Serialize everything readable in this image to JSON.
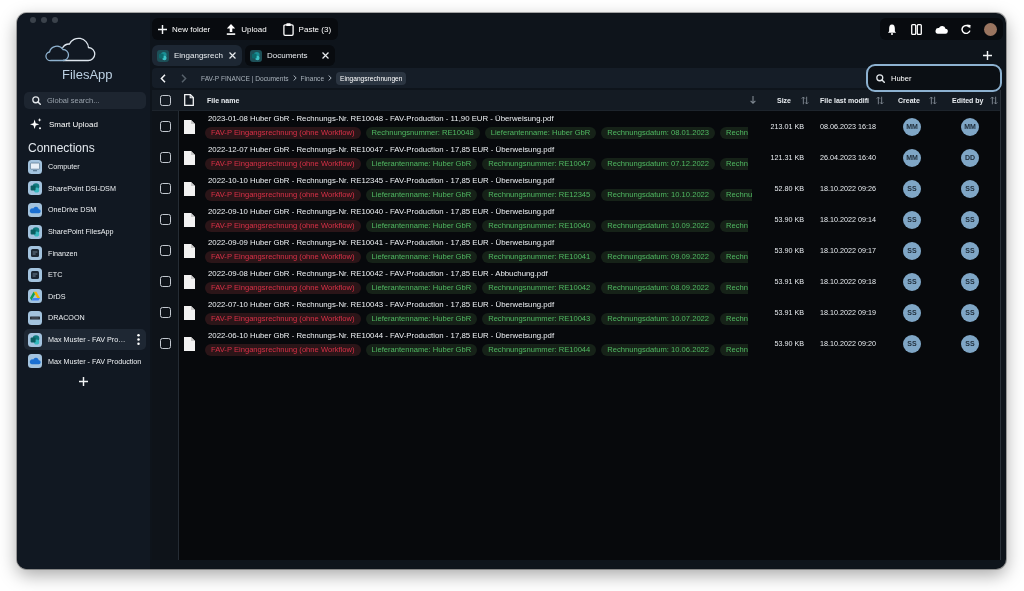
{
  "sidebar": {
    "app_name": "FilesApp",
    "search": {
      "placeholder": "Global search..."
    },
    "smart_upload": "Smart Upload",
    "connections_title": "Connections",
    "connections": [
      {
        "label": "Computer",
        "kind": "computer",
        "selected": false
      },
      {
        "label": "SharePoint DSI-DSM",
        "kind": "sharepoint",
        "selected": false
      },
      {
        "label": "OneDrive DSM",
        "kind": "onedrive",
        "selected": false
      },
      {
        "label": "SharePoint FilesApp",
        "kind": "sharepoint",
        "selected": false
      },
      {
        "label": "Finanzen",
        "kind": "storage",
        "selected": false
      },
      {
        "label": "ETC",
        "kind": "storage",
        "selected": false
      },
      {
        "label": "DrDS",
        "kind": "gdrive",
        "selected": false
      },
      {
        "label": "DRACOON",
        "kind": "dracoon",
        "selected": false
      },
      {
        "label": "Max Muster - FAV Pro…",
        "kind": "sharepoint",
        "selected": true
      },
      {
        "label": "Max Muster - FAV Production",
        "kind": "onedrive",
        "selected": false
      }
    ]
  },
  "toolbar": [
    {
      "kind": "new-folder",
      "label": "New folder"
    },
    {
      "kind": "upload",
      "label": "Upload"
    },
    {
      "kind": "paste",
      "label": "Paste (3)"
    }
  ],
  "tabs": [
    {
      "label": "Eingangsrech",
      "selected": true
    },
    {
      "label": "Documents",
      "selected": false
    }
  ],
  "breadcrumb": {
    "nav": [
      {
        "kind": "back",
        "disabled": false
      },
      {
        "kind": "forward",
        "disabled": true
      }
    ],
    "crumbs": [
      {
        "label": "FAV-P FINANCE | Documents",
        "selected": false
      },
      {
        "label": "Finance",
        "selected": false
      },
      {
        "label": "Eingangsrechnungen",
        "selected": true
      }
    ]
  },
  "search": {
    "value": "Huber",
    "focused": true
  },
  "table": {
    "header_checked": false,
    "columns": [
      {
        "label": "File name",
        "sorted": true
      },
      {
        "label": "Size",
        "sorted": false
      },
      {
        "label": "File last modifi",
        "sorted": false
      },
      {
        "label": "Create",
        "sorted": false
      },
      {
        "label": "Edited by",
        "sorted": false
      }
    ],
    "rows": [
      {
        "checked": false,
        "name": "2023-01-08 Huber GbR - Rechnungs-Nr. RE10048 - FAV-Production - 11,90 EUR - Überweisung.pdf",
        "tags": [
          {
            "label": "FAV-P Eingangsrechnung (ohne Workflow)",
            "color": "#2b1518"
          },
          {
            "label": "Rechnungsnummer: RE10048",
            "color": "#162218"
          },
          {
            "label": "Lieferantenname: Huber GbR",
            "color": "#162218"
          },
          {
            "label": "Rechnungsdatum: 08.01.2023",
            "color": "#162218"
          },
          {
            "label": "Rechn",
            "color": "#162218"
          }
        ],
        "size": "213.01 KB",
        "modified": "08.06.2023 16:18",
        "created_by": "MM",
        "edited_by": "MM"
      },
      {
        "checked": false,
        "name": "2022-12-07 Huber GbR - Rechnungs-Nr. RE10047 - FAV-Production - 17,85 EUR - Überweisung.pdf",
        "tags": [
          {
            "label": "FAV-P Eingangsrechnung (ohne Workflow)",
            "color": "#2b1518"
          },
          {
            "label": "Lieferantenname: Huber GbR",
            "color": "#162218"
          },
          {
            "label": "Rechnungsnummer: RE10047",
            "color": "#162218"
          },
          {
            "label": "Rechnungsdatum: 07.12.2022",
            "color": "#162218"
          },
          {
            "label": "Rechn",
            "color": "#162218"
          }
        ],
        "size": "121.31 KB",
        "modified": "26.04.2023 16:40",
        "created_by": "MM",
        "edited_by": "DD"
      },
      {
        "checked": false,
        "name": "2022-10-10 Huber GbR - Rechnungs-Nr. RE12345 - FAV-Production - 17,85 EUR - Überweisung.pdf",
        "tags": [
          {
            "label": "FAV-P Eingangsrechnung (ohne Workflow)",
            "color": "#2b1518"
          },
          {
            "label": "Lieferantenname: Huber GbR",
            "color": "#162218"
          },
          {
            "label": "Rechnungsnummer: RE12345",
            "color": "#162218"
          },
          {
            "label": "Rechnungsdatum: 10.10.2022",
            "color": "#162218"
          },
          {
            "label": "Rechnu",
            "color": "#162218"
          }
        ],
        "size": "52.80 KB",
        "modified": "18.10.2022 09:26",
        "created_by": "SS",
        "edited_by": "SS"
      },
      {
        "checked": false,
        "name": "2022-09-10 Huber GbR - Rechnungs-Nr. RE10040 - FAV-Production - 17,85 EUR - Überweisung.pdf",
        "tags": [
          {
            "label": "FAV-P Eingangsrechnung (ohne Workflow)",
            "color": "#2b1518"
          },
          {
            "label": "Lieferantenname: Huber GbR",
            "color": "#162218"
          },
          {
            "label": "Rechnungsnummer: RE10040",
            "color": "#162218"
          },
          {
            "label": "Rechnungsdatum: 10.09.2022",
            "color": "#162218"
          },
          {
            "label": "Rechn",
            "color": "#162218"
          }
        ],
        "size": "53.90 KB",
        "modified": "18.10.2022 09:14",
        "created_by": "SS",
        "edited_by": "SS"
      },
      {
        "checked": false,
        "name": "2022-09-09 Huber GbR - Rechnungs-Nr. RE10041 - FAV-Production - 17,85 EUR - Überweisung.pdf",
        "tags": [
          {
            "label": "FAV-P Eingangsrechnung (ohne Workflow)",
            "color": "#2b1518"
          },
          {
            "label": "Lieferantenname: Huber GbR",
            "color": "#162218"
          },
          {
            "label": "Rechnungsnummer: RE10041",
            "color": "#162218"
          },
          {
            "label": "Rechnungsdatum: 09.09.2022",
            "color": "#162218"
          },
          {
            "label": "Rechn",
            "color": "#162218"
          }
        ],
        "size": "53.90 KB",
        "modified": "18.10.2022 09:17",
        "created_by": "SS",
        "edited_by": "SS"
      },
      {
        "checked": false,
        "name": "2022-09-08 Huber GbR - Rechnungs-Nr. RE10042 - FAV-Production - 17,85 EUR - Abbuchung.pdf",
        "tags": [
          {
            "label": "FAV-P Eingangsrechnung (ohne Workflow)",
            "color": "#2b1518"
          },
          {
            "label": "Lieferantenname: Huber GbR",
            "color": "#162218"
          },
          {
            "label": "Rechnungsnummer: RE10042",
            "color": "#162218"
          },
          {
            "label": "Rechnungsdatum: 08.09.2022",
            "color": "#162218"
          },
          {
            "label": "Rechn",
            "color": "#162218"
          }
        ],
        "size": "53.91 KB",
        "modified": "18.10.2022 09:18",
        "created_by": "SS",
        "edited_by": "SS"
      },
      {
        "checked": false,
        "name": "2022-07-10 Huber GbR - Rechnungs-Nr. RE10043 - FAV-Production - 17,85 EUR - Überweisung.pdf",
        "tags": [
          {
            "label": "FAV-P Eingangsrechnung (ohne Workflow)",
            "color": "#2b1518"
          },
          {
            "label": "Lieferantenname: Huber GbR",
            "color": "#162218"
          },
          {
            "label": "Rechnungsnummer: RE10043",
            "color": "#162218"
          },
          {
            "label": "Rechnungsdatum: 10.07.2022",
            "color": "#162218"
          },
          {
            "label": "Rechn",
            "color": "#162218"
          }
        ],
        "size": "53.91 KB",
        "modified": "18.10.2022 09:19",
        "created_by": "SS",
        "edited_by": "SS"
      },
      {
        "checked": false,
        "name": "2022-06-10 Huber GbR - Rechnungs-Nr. RE10044 - FAV-Production - 17,85 EUR - Überweisung.pdf",
        "tags": [
          {
            "label": "FAV-P Eingangsrechnung (ohne Workflow)",
            "color": "#2b1518"
          },
          {
            "label": "Lieferantenname: Huber GbR",
            "color": "#162218"
          },
          {
            "label": "Rechnungsnummer: RE10044",
            "color": "#162218"
          },
          {
            "label": "Rechnungsdatum: 10.06.2022",
            "color": "#162218"
          },
          {
            "label": "Rechn",
            "color": "#162218"
          }
        ],
        "size": "53.90 KB",
        "modified": "18.10.2022 09:20",
        "created_by": "SS",
        "edited_by": "SS"
      }
    ]
  }
}
